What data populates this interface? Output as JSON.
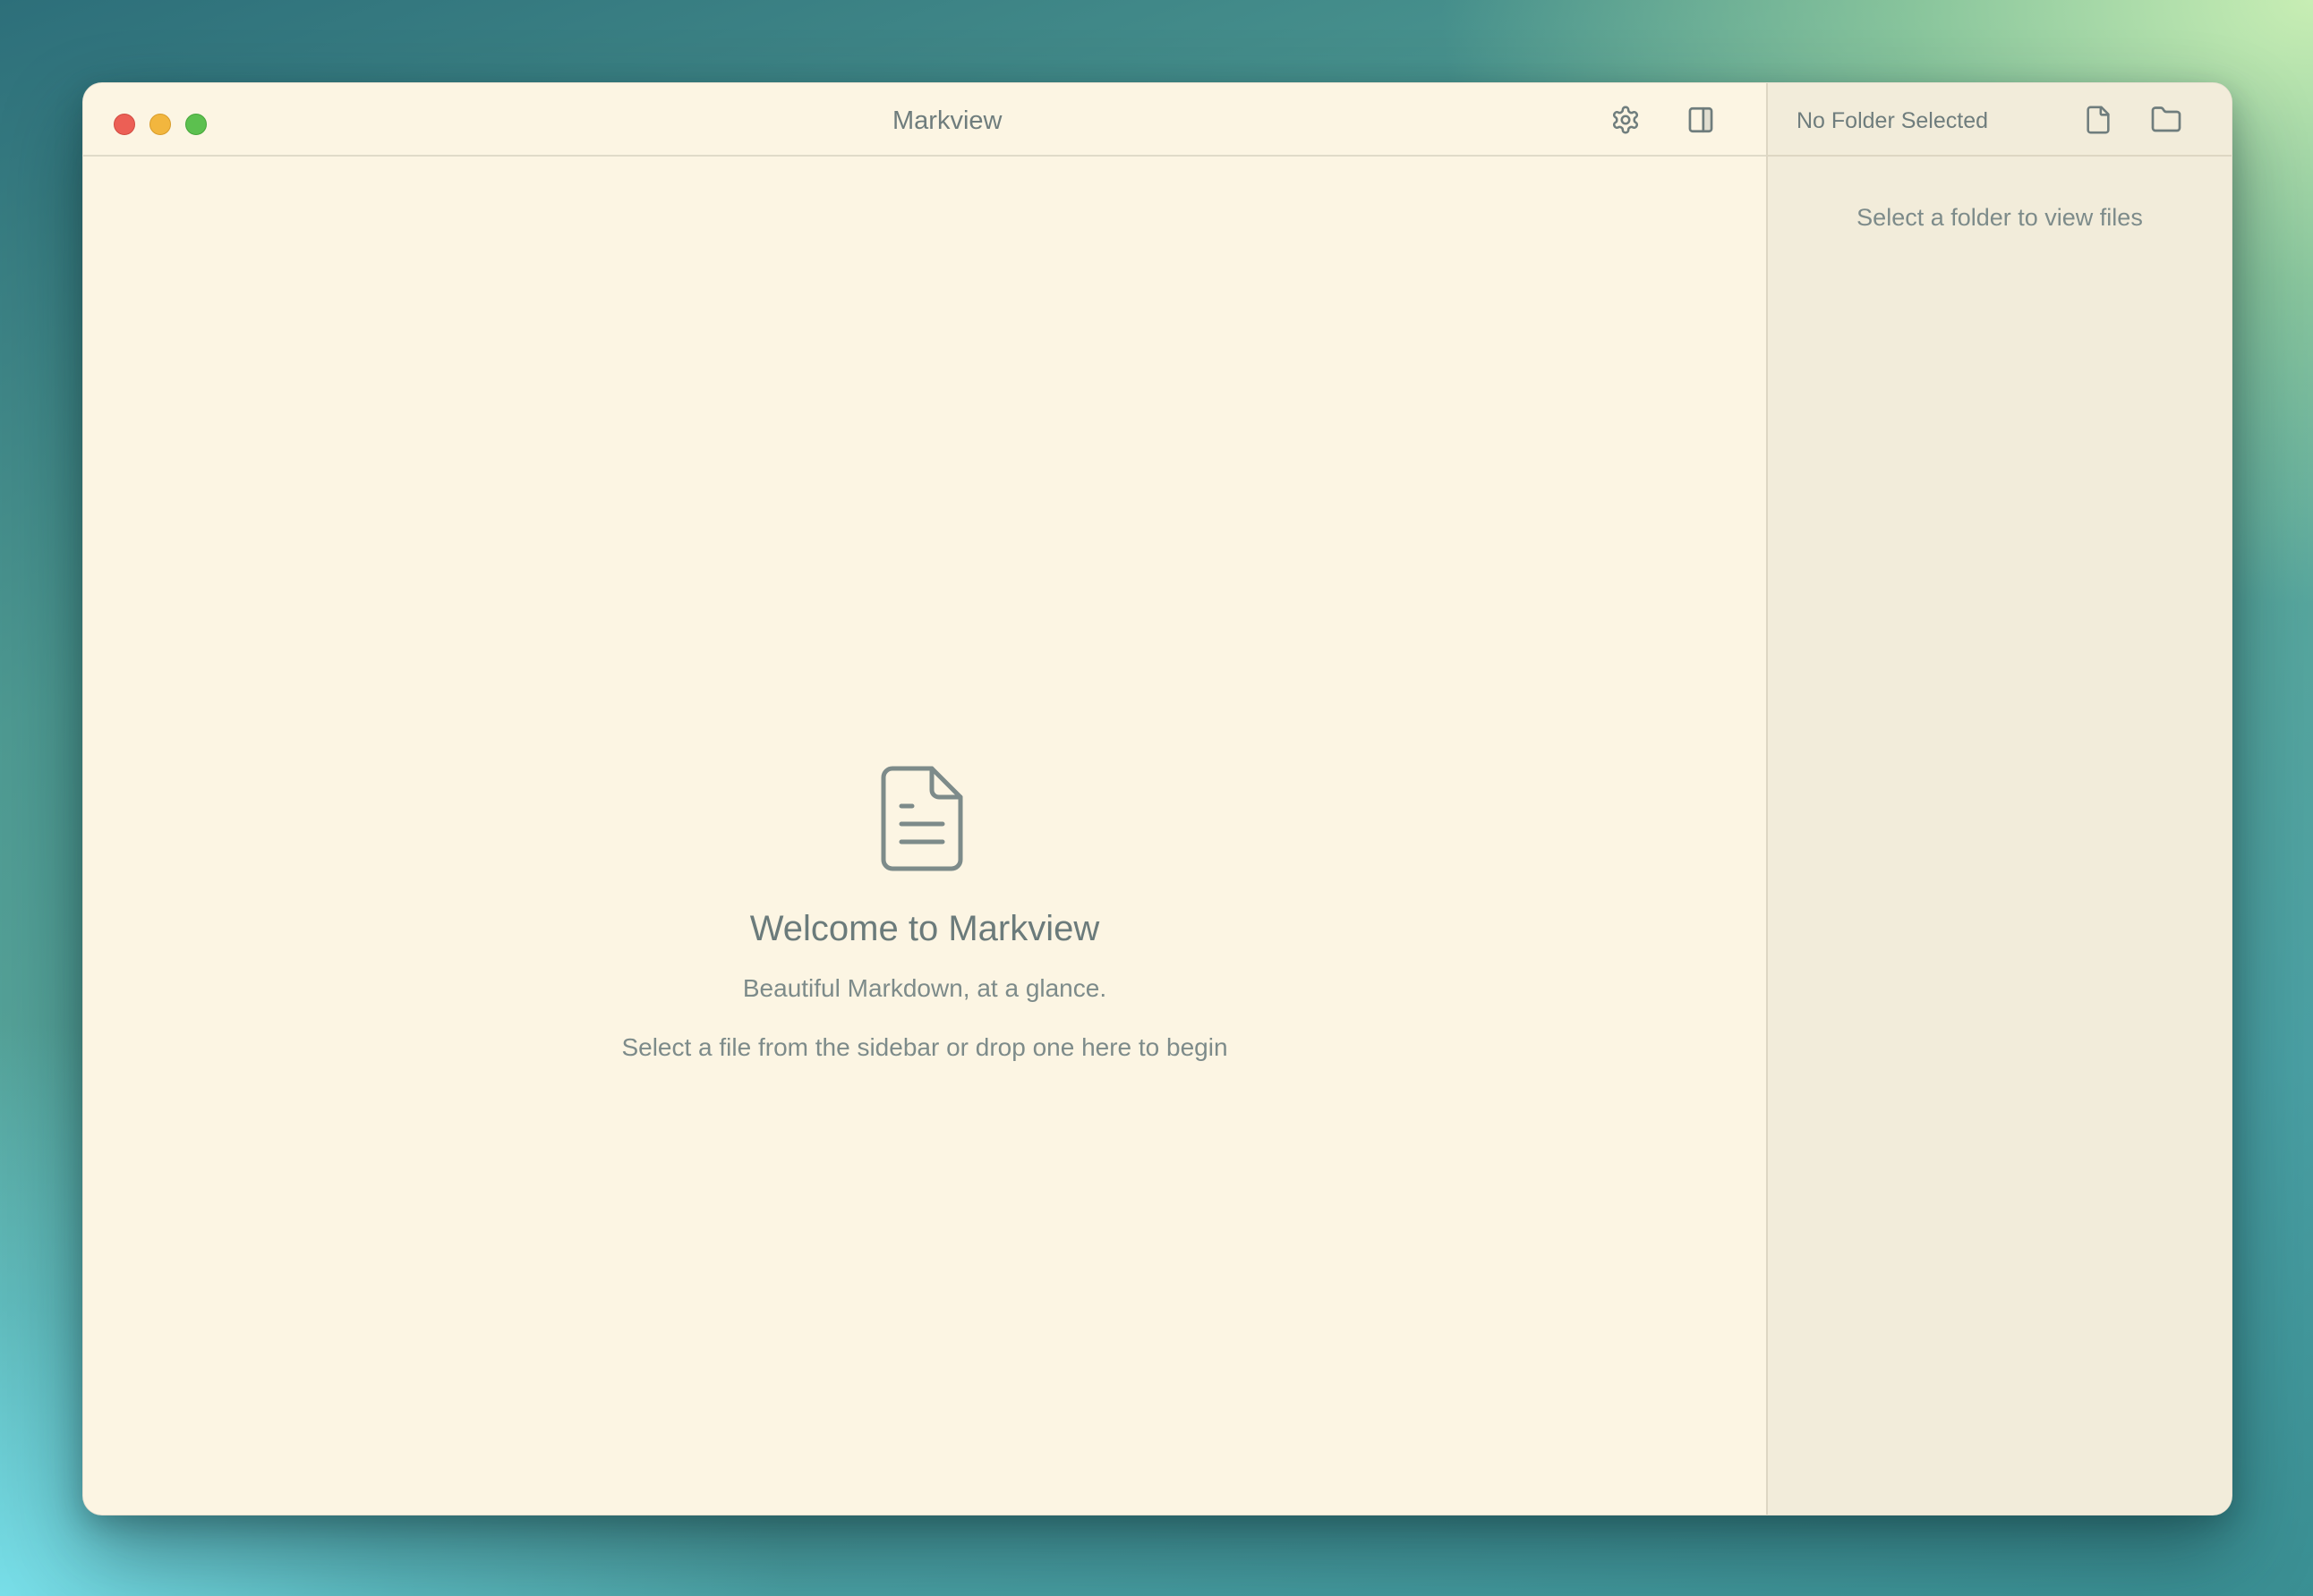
{
  "window": {
    "title": "Markview"
  },
  "toolbar": {
    "settings_icon": "gear-icon",
    "toggle_sidebar_icon": "sidebar-panel-icon"
  },
  "welcome": {
    "icon": "document-icon",
    "title": "Welcome to Markview",
    "subtitle": "Beautiful Markdown, at a glance.",
    "hint": "Select a file from the sidebar or drop one here to begin"
  },
  "sidebar": {
    "folder_name": "No Folder Selected",
    "open_file_icon": "file-icon",
    "open_folder_icon": "folder-icon",
    "empty_message": "Select a folder to view files"
  },
  "colors": {
    "background": "#fcf5e3",
    "sidebar_background": "#f2ecda",
    "text_muted": "#7d8b8a",
    "close": "#ec5f55",
    "minimize": "#f2b63e",
    "maximize": "#5cc04f"
  }
}
